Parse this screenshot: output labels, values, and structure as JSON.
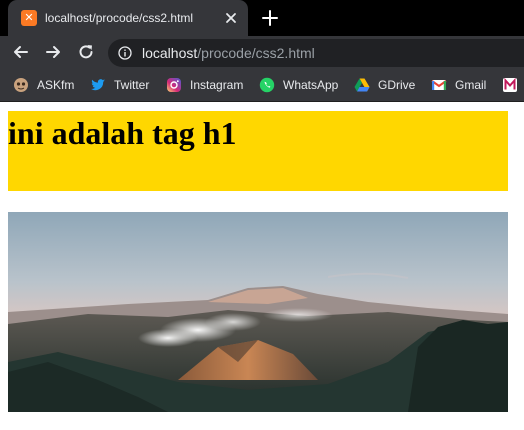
{
  "tab": {
    "favicon": "xampp-icon",
    "title": "localhost/procode/css2.html"
  },
  "toolbar": {
    "url_host": "localhost",
    "url_path": "/procode/css2.html"
  },
  "bookmarks": [
    {
      "label": "ASKfm",
      "icon": "askfm-icon"
    },
    {
      "label": "Twitter",
      "icon": "twitter-icon"
    },
    {
      "label": "Instagram",
      "icon": "instagram-icon"
    },
    {
      "label": "WhatsApp",
      "icon": "whatsapp-icon"
    },
    {
      "label": "GDrive",
      "icon": "gdrive-icon"
    },
    {
      "label": "Gmail",
      "icon": "gmail-icon"
    },
    {
      "label": "",
      "icon": "bookmark-m-icon"
    }
  ],
  "page": {
    "heading": "ini adalah tag h1",
    "heading_bg": "#ffd700",
    "image": "mountain-landscape-photo"
  },
  "colors": {
    "tabstrip": "#000000",
    "chrome": "#35363a",
    "omnibox": "#202124"
  }
}
